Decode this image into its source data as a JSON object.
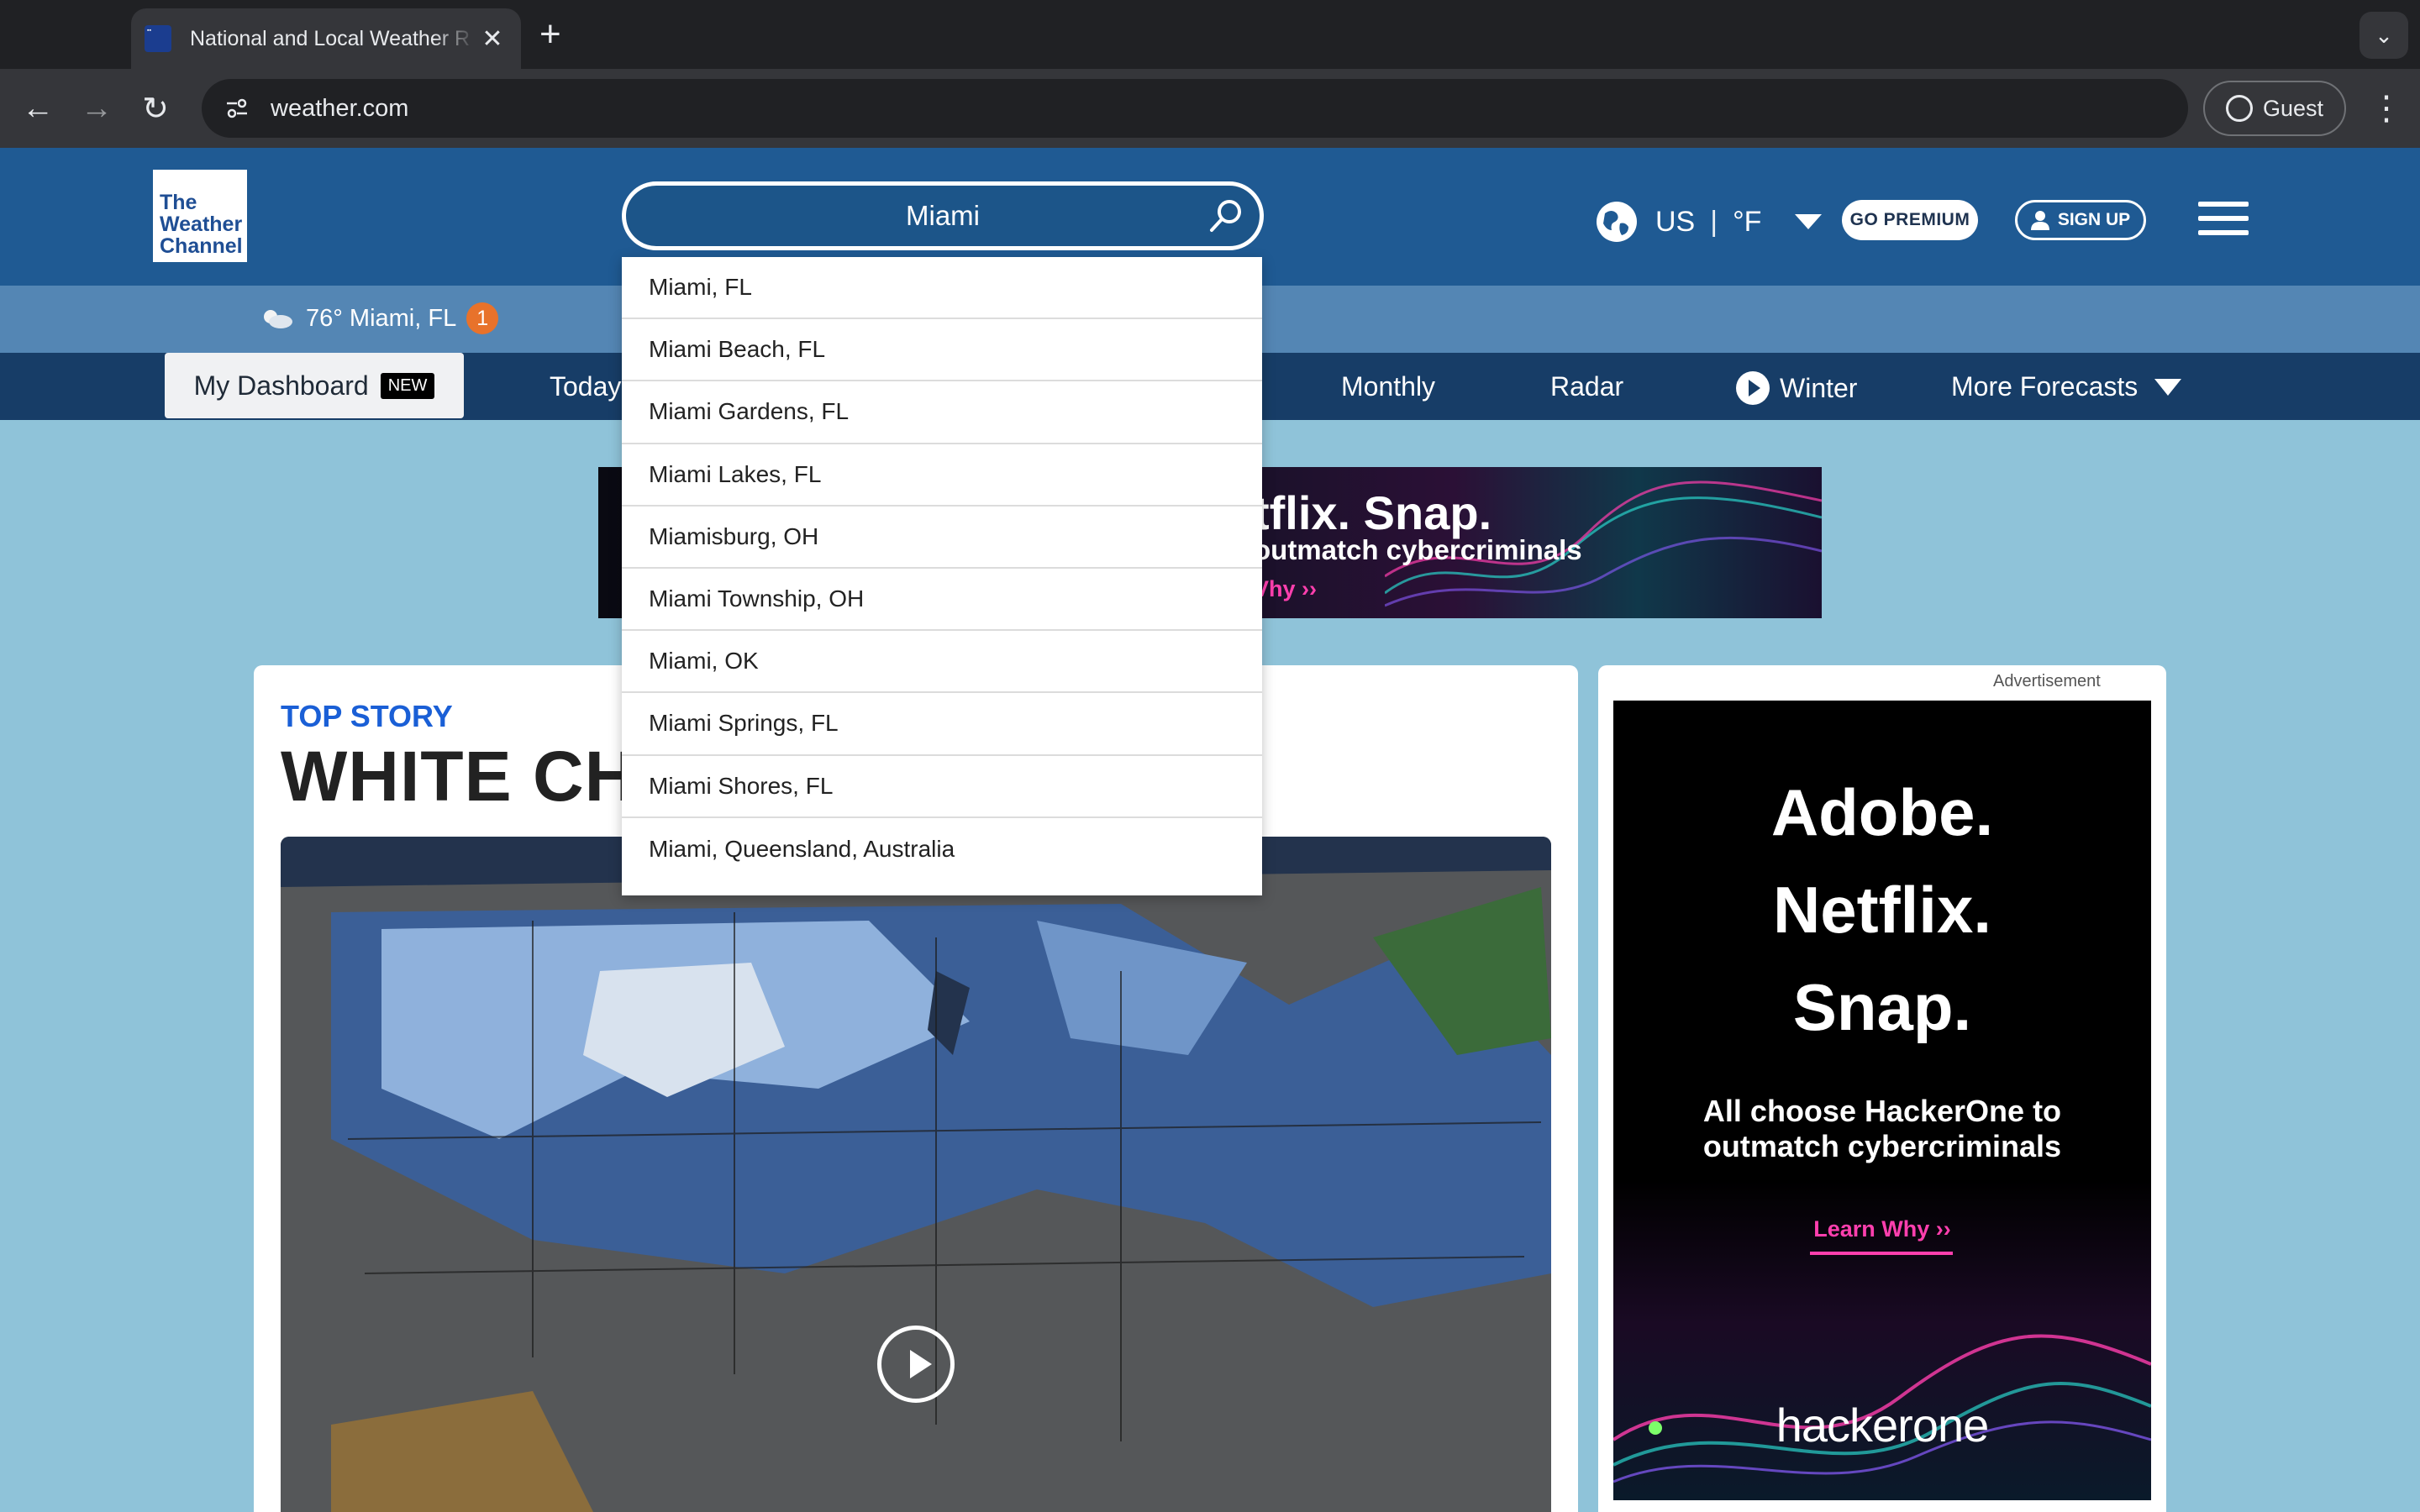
{
  "browser": {
    "tab_title": "National and Local Weather R",
    "tab_close": "✕",
    "new_tab": "+",
    "tab_menu": "⌄",
    "back": "←",
    "forward": "→",
    "reload": "↻",
    "url": "weather.com",
    "profile_label": "Guest",
    "menu": "⋮"
  },
  "header": {
    "logo_text": [
      "The",
      "Weather",
      "Channel"
    ],
    "search_value": "Miami",
    "locale_country": "US",
    "locale_separator": "|",
    "locale_unit": "°F",
    "premium_label": "GO PREMIUM",
    "signup_label": "SIGN UP"
  },
  "current": {
    "temp": "76°",
    "location": "Miami, FL",
    "alert_count": "1"
  },
  "nav": {
    "dashboard_label": "My Dashboard",
    "new_badge": "NEW",
    "items": [
      "Today",
      "Monthly",
      "Radar",
      "Winter",
      "More Forecasts"
    ]
  },
  "banner_ad": {
    "line1": "tflix. Snap.",
    "line2": "outmatch cybercriminals",
    "line3": "Vhy ››"
  },
  "story": {
    "label": "TOP STORY",
    "headline": "WHITE CHI"
  },
  "side_ad": {
    "label": "Advertisement",
    "brands": [
      "Adobe.",
      "Netflix.",
      "Snap."
    ],
    "copy": "All choose HackerOne to outmatch cybercriminals",
    "cta": "Learn Why ››",
    "logo": "hackerone"
  },
  "autocomplete": {
    "results": [
      "Miami, FL",
      "Miami Beach, FL",
      "Miami Gardens, FL",
      "Miami Lakes, FL",
      "Miamisburg, OH",
      "Miami Township, OH",
      "Miami, OK",
      "Miami Springs, FL",
      "Miami Shores, FL",
      "Miami, Queensland, Australia"
    ]
  },
  "colors": {
    "header_bg": "#1f5a93",
    "strip_bg": "#5486b4",
    "nav_bg": "#173d67",
    "accent_blue": "#1a5fd6",
    "alert_orange": "#e8722b",
    "ad_pink": "#ff3fae"
  },
  "icons": {
    "search": "search-icon",
    "globe": "globe-icon",
    "user": "user-icon",
    "menu": "hamburger-icon",
    "weather": "partly-cloudy-icon",
    "play": "play-icon"
  }
}
